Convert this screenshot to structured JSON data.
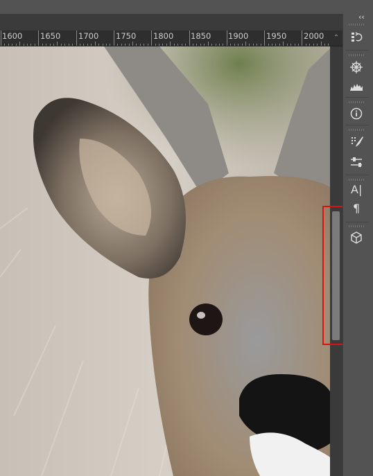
{
  "ruler": {
    "labels": [
      "1600",
      "1650",
      "1700",
      "1750",
      "1800",
      "1850",
      "1900",
      "1950",
      "2000"
    ]
  },
  "toolbar": {
    "collapse_glyph": "‹‹",
    "items": [
      {
        "name": "history-icon"
      },
      {
        "name": "navigator-icon"
      },
      {
        "name": "histogram-icon"
      },
      {
        "name": "info-icon"
      },
      {
        "name": "brush-settings-icon"
      },
      {
        "name": "adjustments-icon"
      },
      {
        "name": "character-icon",
        "glyph": "A|"
      },
      {
        "name": "paragraph-icon",
        "glyph": "¶"
      },
      {
        "name": "3d-icon"
      }
    ]
  },
  "colors": {
    "panel_bg": "#535353",
    "ruler_bg": "#2e2e2e",
    "scroll_thumb": "#7b7b7b",
    "highlight": "#e01010"
  }
}
